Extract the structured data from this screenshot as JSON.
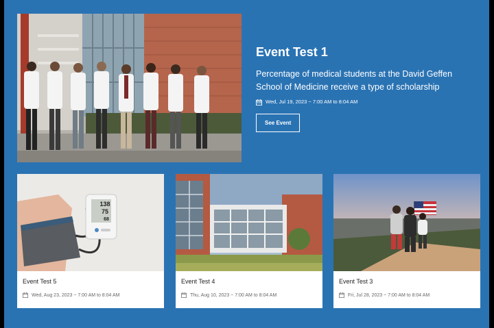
{
  "featured": {
    "title": "Event Test 1",
    "description": "Percentage of medical students at the David Geffen School of Medicine receive a type of scholarship",
    "date": "Wed, Jul 19, 2023 ~ 7:00 AM to 8:04 AM",
    "button_label": "See Event",
    "image_alt": "Group of medical students in white coats"
  },
  "cards": [
    {
      "title": "Event Test 5",
      "date": "Wed, Aug 23, 2023 ~ 7:00 AM to 8:04 AM",
      "monitor": {
        "top": "138",
        "mid": "75",
        "bottom": "68"
      }
    },
    {
      "title": "Event Test 4",
      "date": "Thu, Aug 10, 2023 ~ 7:00 AM to 8:04 AM"
    },
    {
      "title": "Event Test 3",
      "date": "Fri, Jul 28, 2023 ~ 7:00 AM to 8:04 AM"
    }
  ],
  "colors": {
    "background": "#2a73b3",
    "card": "#ffffff",
    "text_on_blue": "#ffffff"
  },
  "icons": {
    "date": "calendar-icon"
  }
}
